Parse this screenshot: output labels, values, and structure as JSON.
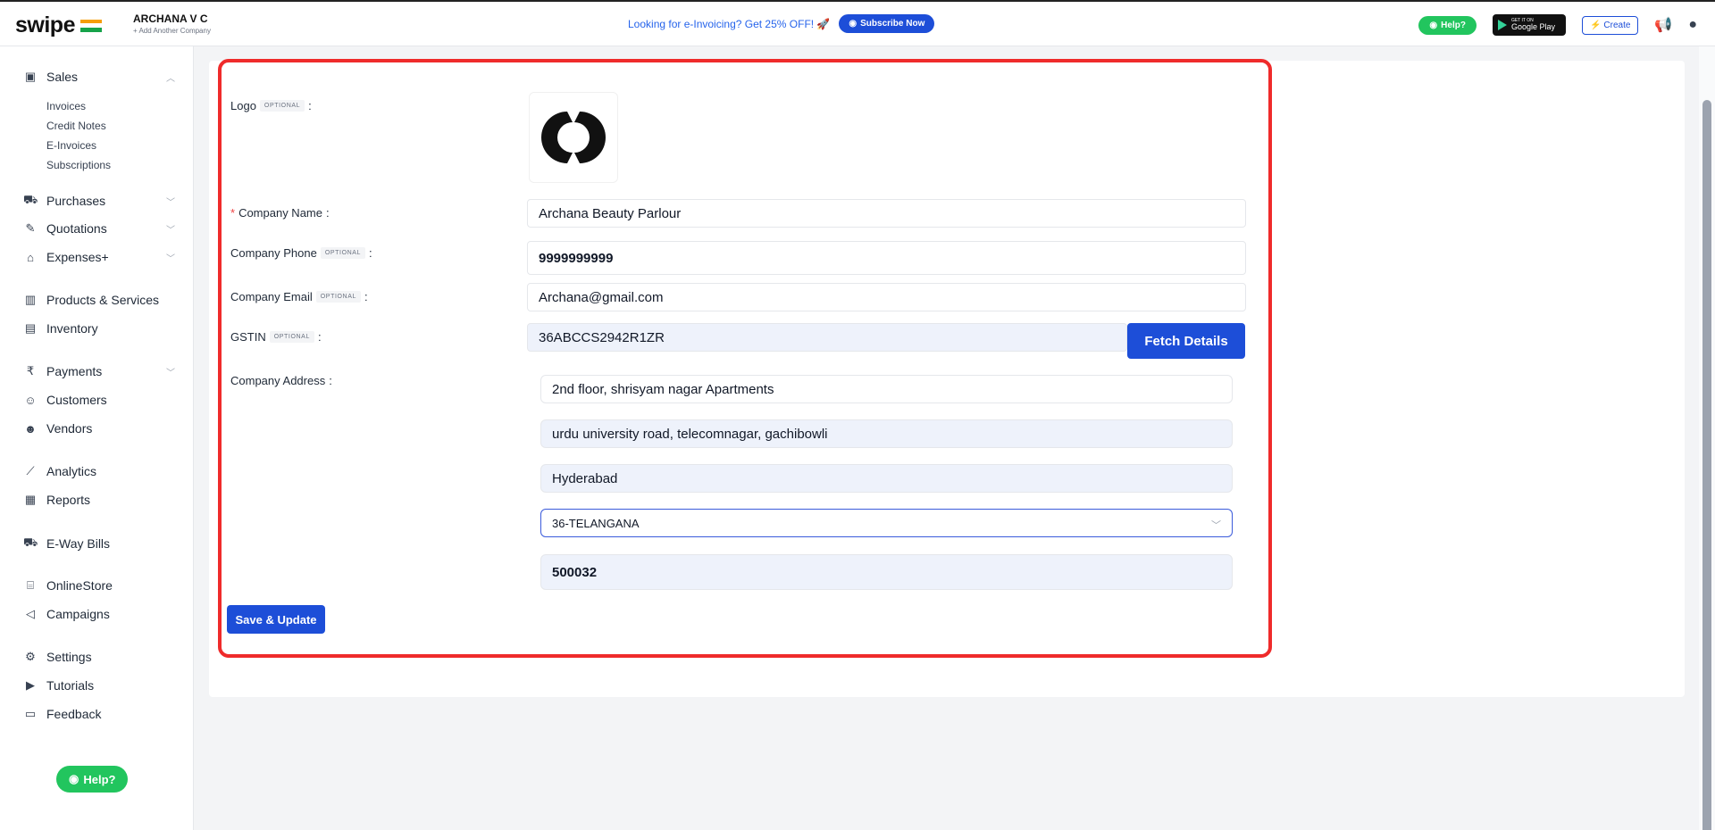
{
  "brand": {
    "name": "swipe"
  },
  "company": {
    "name": "ARCHANA V C",
    "add_link": "+ Add Another Company"
  },
  "promo": {
    "text": "Looking for e-Invoicing? Get 25% OFF! 🚀",
    "button": "Subscribe Now"
  },
  "header": {
    "help": "Help?",
    "google_play_small": "GET IT ON",
    "google_play": "Google Play",
    "create": "Create"
  },
  "sidebar": {
    "sales": "Sales",
    "sales_sub": [
      "Invoices",
      "Credit Notes",
      "E-Invoices",
      "Subscriptions"
    ],
    "purchases": "Purchases",
    "quotations": "Quotations",
    "expenses": "Expenses+",
    "products": "Products & Services",
    "inventory": "Inventory",
    "payments": "Payments",
    "customers": "Customers",
    "vendors": "Vendors",
    "analytics": "Analytics",
    "reports": "Reports",
    "eway": "E-Way Bills",
    "onlinestore": "OnlineStore",
    "campaigns": "Campaigns",
    "settings": "Settings",
    "tutorials": "Tutorials",
    "feedback": "Feedback",
    "help": "Help?"
  },
  "form": {
    "optional_tag": "OPTIONAL",
    "logo_label": "Logo",
    "company_name_label": "Company Name",
    "company_name": "Archana Beauty Parlour",
    "phone_label": "Company Phone",
    "phone": "9999999999",
    "email_label": "Company Email",
    "email": "Archana@gmail.com",
    "gstin_label": "GSTIN",
    "gstin": "36ABCCS2942R1ZR",
    "fetch_button": "Fetch Details",
    "address_label": "Company Address",
    "address_line1": "2nd floor, shrisyam nagar Apartments",
    "address_line2": "urdu university road, telecomnagar, gachibowli",
    "city": "Hyderabad",
    "state": "36-TELANGANA",
    "pincode": "500032",
    "save_button": "Save & Update"
  },
  "colors": {
    "accent": "#1d4ed8",
    "green": "#22c55e",
    "highlight": "#ef2b2b"
  }
}
